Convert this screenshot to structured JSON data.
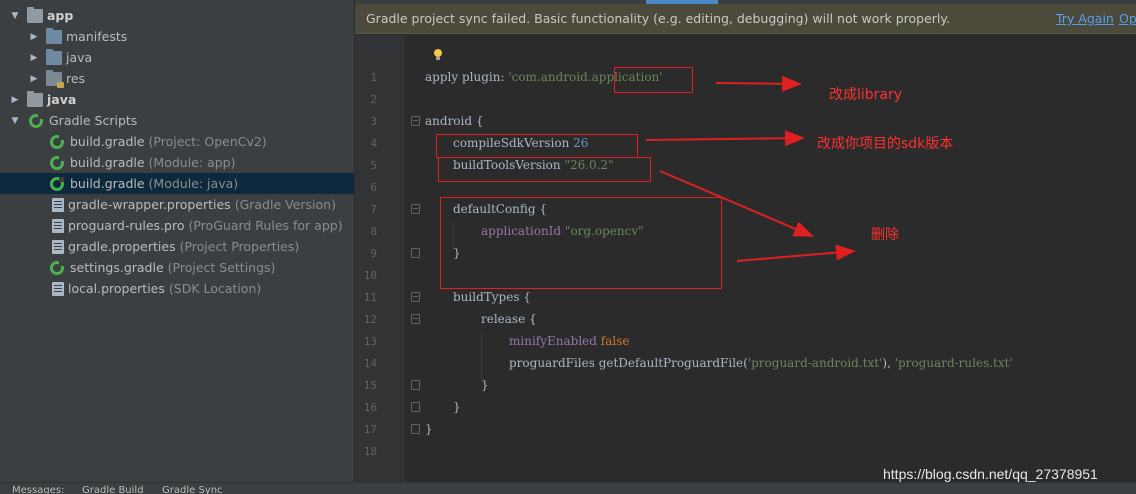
{
  "project_tree": {
    "items": [
      {
        "label": "app",
        "note": "",
        "icon": "folder-icon",
        "expanded": true,
        "bold": true
      },
      {
        "label": "manifests",
        "note": "",
        "icon": "folder-icon",
        "expanded": false,
        "bold": false
      },
      {
        "label": "java",
        "note": "",
        "icon": "folder-icon",
        "expanded": false,
        "bold": false
      },
      {
        "label": "res",
        "note": "",
        "icon": "res-folder-icon",
        "expanded": false,
        "bold": false
      },
      {
        "label": "java",
        "note": "",
        "icon": "folder-icon",
        "expanded": false,
        "bold": true
      },
      {
        "label": "Gradle Scripts",
        "note": "",
        "icon": "gradle-icon",
        "expanded": true,
        "bold": false
      },
      {
        "label": "build.gradle",
        "note": "(Project: OpenCv2)",
        "icon": "gradle-icon",
        "bold": false
      },
      {
        "label": "build.gradle",
        "note": "(Module: app)",
        "icon": "gradle-icon",
        "bold": false
      },
      {
        "label": "build.gradle",
        "note": "(Module: java)",
        "icon": "gradle-icon",
        "bold": false,
        "selected": true
      },
      {
        "label": "gradle-wrapper.properties",
        "note": "(Gradle Version)",
        "icon": "properties-file-icon",
        "bold": false
      },
      {
        "label": "proguard-rules.pro",
        "note": "(ProGuard Rules for app)",
        "icon": "properties-file-icon",
        "bold": false
      },
      {
        "label": "gradle.properties",
        "note": "(Project Properties)",
        "icon": "properties-file-icon",
        "bold": false
      },
      {
        "label": "settings.gradle",
        "note": "(Project Settings)",
        "icon": "gradle-icon",
        "bold": false
      },
      {
        "label": "local.properties",
        "note": "(SDK Location)",
        "icon": "properties-file-icon",
        "bold": false
      }
    ]
  },
  "bottom_bar": {
    "tabs": [
      "Messages:",
      "Gradle Build",
      "Gradle Sync"
    ]
  },
  "banner": {
    "message": "Gradle project sync failed. Basic functionality (e.g. editing, debugging) will not work properly.",
    "try_again": "Try Again",
    "open_file": "Ope"
  },
  "editor": {
    "line_numbers": [
      "1",
      "2",
      "3",
      "4",
      "5",
      "6",
      "7",
      "8",
      "9",
      "10",
      "11",
      "12",
      "13",
      "14",
      "15",
      "16",
      "17",
      "18"
    ],
    "lines": {
      "l1_a": "apply ",
      "l1_b": "plugin",
      "l1_c": ": ",
      "l1_d": "'com.android.application'",
      "l3": "android {",
      "l4_a": "compileSdkVersion ",
      "l4_b": "26",
      "l5_a": "buildToolsVersion ",
      "l5_b": "\"26.0.2\"",
      "l7": "defaultConfig {",
      "l8_a": "applicationId ",
      "l8_b": "\"org.opencv\"",
      "l9": "}",
      "l11": "buildTypes {",
      "l12": "release {",
      "l13_a": "minifyEnabled ",
      "l13_b": "false",
      "l14_a": "proguardFiles getDefaultProguardFile(",
      "l14_b": "'proguard-android.txt'",
      "l14_c": "), ",
      "l14_d": "'proguard-rules.txt'",
      "l15": "}",
      "l16": "}",
      "l17": "}"
    }
  },
  "annotations": {
    "note1": "改成library",
    "note2": "改成你项目的sdk版本",
    "note3": "删除",
    "color": "#e02020"
  },
  "watermark": "https://blog.csdn.net/qq_27378951",
  "colors": {
    "editor_bg": "#2b2b2b",
    "sidebar_bg": "#3c3f41",
    "selection": "#0d293e",
    "string": "#6a8759",
    "number": "#6897bb",
    "keyword": "#cc7832",
    "link": "#589df6"
  }
}
